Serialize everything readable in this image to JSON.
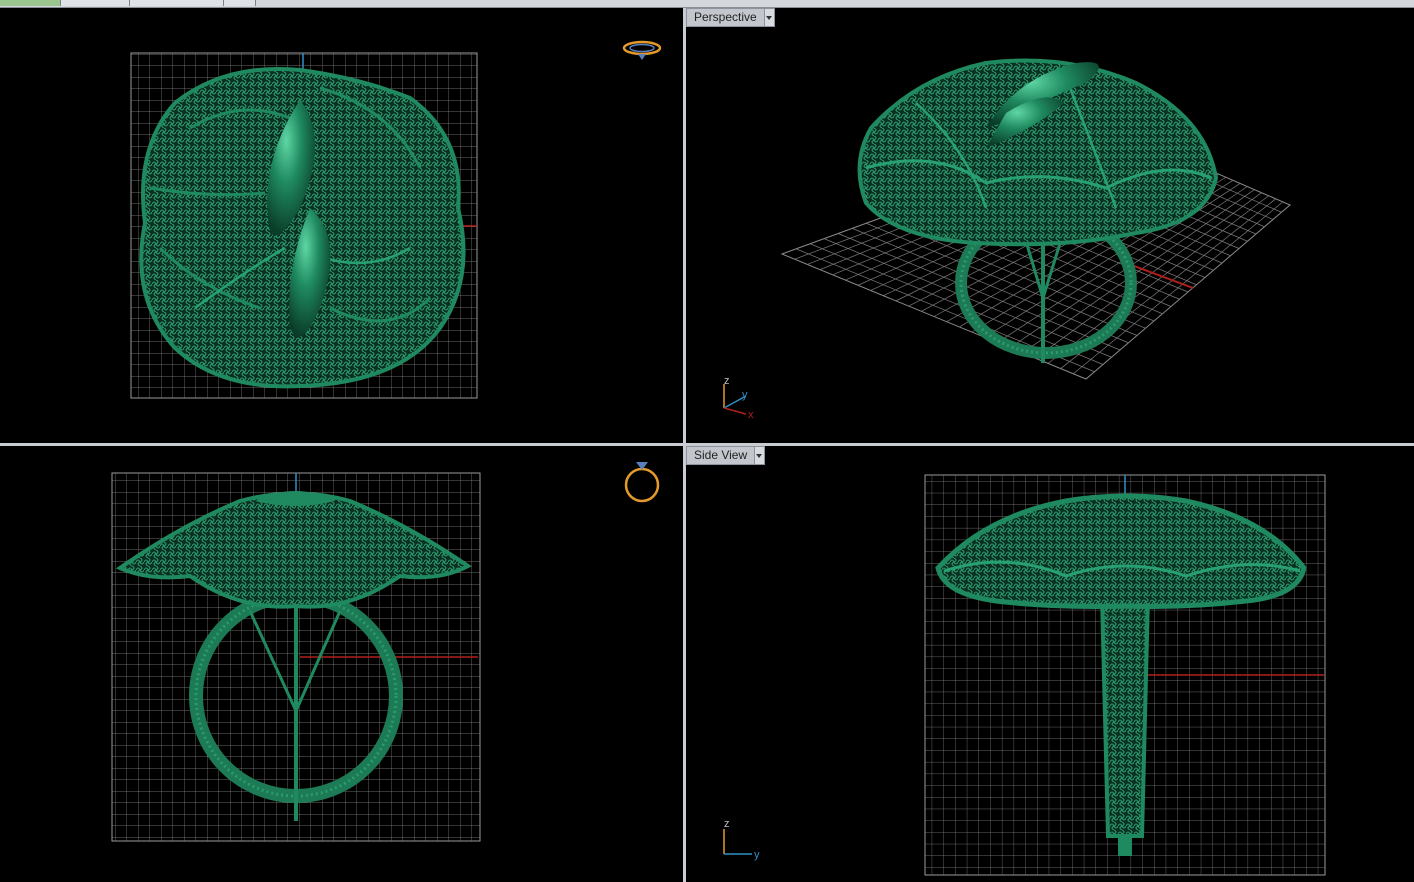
{
  "tabs": [
    {
      "label": "",
      "active": true
    },
    {
      "label": "",
      "active": false
    },
    {
      "label": "",
      "active": false
    },
    {
      "label": "",
      "active": false
    }
  ],
  "viewports": {
    "top_left": {
      "label": ""
    },
    "top_right": {
      "label": "Perspective",
      "dropdown": "dropdown-arrow-icon"
    },
    "bottom_left": {
      "label": ""
    },
    "bottom_right": {
      "label": "Side View",
      "dropdown": "dropdown-arrow-icon"
    }
  },
  "axes": {
    "perspective": {
      "z": "z",
      "y": "y",
      "x": "x"
    },
    "side": {
      "z": "z",
      "y": "y"
    }
  },
  "icons": {
    "ring_top": "ring-top-view-icon",
    "ring_front": "ring-front-view-icon"
  },
  "colors": {
    "model": "#1c7a55",
    "model_highlight": "#3fb98a",
    "grid": "#8a8a8a",
    "axis_red": "#b0201a",
    "axis_blue": "#2f8fc7",
    "gizmo_orange": "#e39a2b"
  }
}
